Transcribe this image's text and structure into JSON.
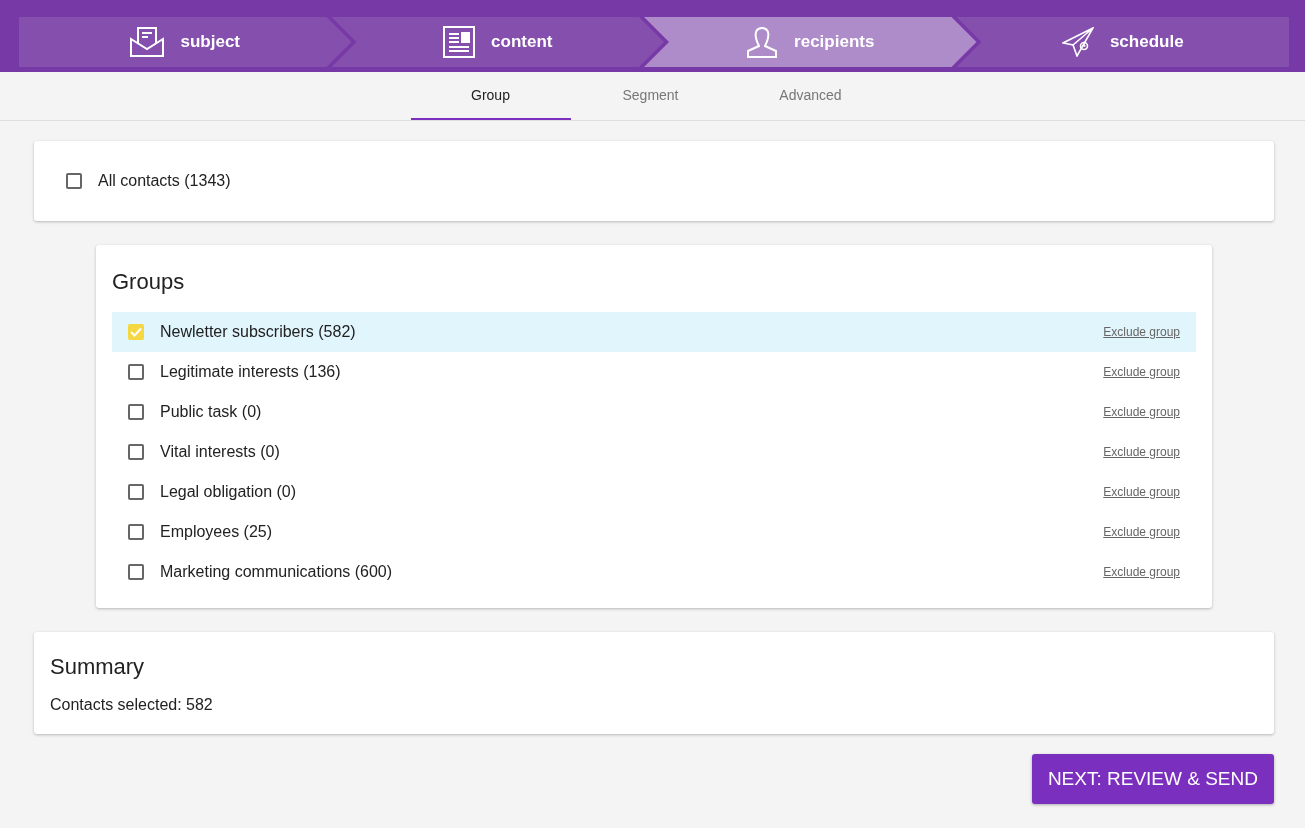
{
  "steps": [
    {
      "label": "subject",
      "kind": "envelope",
      "selected": false
    },
    {
      "label": "content",
      "kind": "document",
      "selected": false
    },
    {
      "label": "recipients",
      "kind": "person",
      "selected": true
    },
    {
      "label": "schedule",
      "kind": "plane",
      "selected": false
    }
  ],
  "tabs": [
    {
      "label": "Group",
      "selected": true
    },
    {
      "label": "Segment",
      "selected": false
    },
    {
      "label": "Advanced",
      "selected": false
    }
  ],
  "all_contacts": {
    "label": "All contacts (1343)",
    "checked": false
  },
  "groups": {
    "title": "Groups",
    "items": [
      {
        "label": "Newletter subscribers (582)",
        "checked": true,
        "action": "Exclude group"
      },
      {
        "label": "Legitimate interests (136)",
        "checked": false,
        "action": "Exclude group"
      },
      {
        "label": "Public task (0)",
        "checked": false,
        "action": "Exclude group"
      },
      {
        "label": "Vital interests (0)",
        "checked": false,
        "action": "Exclude group"
      },
      {
        "label": "Legal obligation (0)",
        "checked": false,
        "action": "Exclude group"
      },
      {
        "label": "Employees (25)",
        "checked": false,
        "action": "Exclude group"
      },
      {
        "label": "Marketing communications (600)",
        "checked": false,
        "action": "Exclude group"
      }
    ]
  },
  "summary": {
    "title": "Summary",
    "text": "Contacts selected: 582"
  },
  "next_button": "NEXT: REVIEW & SEND"
}
